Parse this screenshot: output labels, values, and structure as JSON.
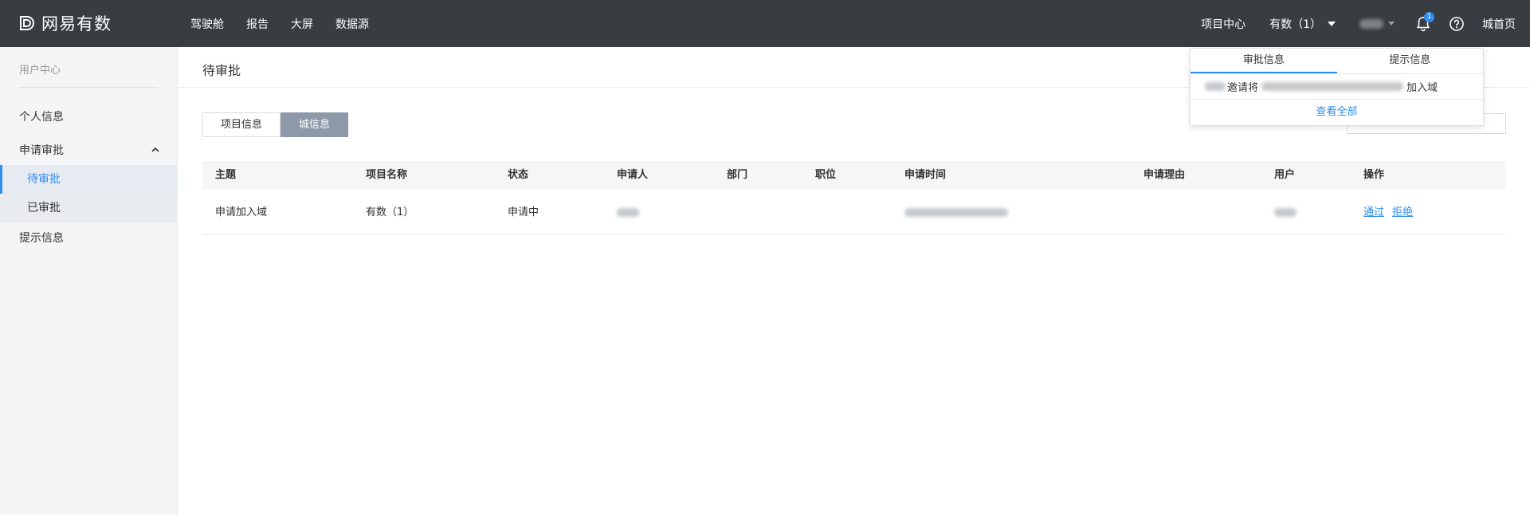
{
  "brand": {
    "logo_text": "网易有数"
  },
  "nav": [
    {
      "label": "驾驶舱"
    },
    {
      "label": "报告"
    },
    {
      "label": "大屏"
    },
    {
      "label": "数据源"
    }
  ],
  "topright": {
    "project_center": "项目中心",
    "domain_selector": "有数（1）",
    "notification_count": "1",
    "domain_home": "城首页"
  },
  "sidebar": {
    "title": "用户中心",
    "personal_info": "个人信息",
    "approval_group": "申请审批",
    "pending": "待审批",
    "approved": "已审批",
    "tips": "提示信息"
  },
  "page": {
    "title": "待审批"
  },
  "tabs": [
    {
      "label": "项目信息",
      "active": false
    },
    {
      "label": "城信息",
      "active": true
    }
  ],
  "table": {
    "headers": [
      "主题",
      "项目名称",
      "状态",
      "申请人",
      "部门",
      "职位",
      "申请时间",
      "申请理由",
      "用户",
      "操作"
    ],
    "rows": [
      {
        "subject": "申请加入域",
        "project": "有数（1）",
        "status": "申请中",
        "actions": {
          "approve": "通过",
          "reject": "拒绝"
        }
      }
    ]
  },
  "popover": {
    "tabs": [
      {
        "label": "审批信息",
        "active": true
      },
      {
        "label": "提示信息",
        "active": false
      }
    ],
    "message_mid": "邀请将",
    "message_end": "加入域",
    "view_all": "查看全部"
  },
  "colors": {
    "topbar": "#373d41",
    "accent": "#2f8df0",
    "active_tab": "#8d99a8",
    "sidebar_bg": "#f4f5f7"
  }
}
